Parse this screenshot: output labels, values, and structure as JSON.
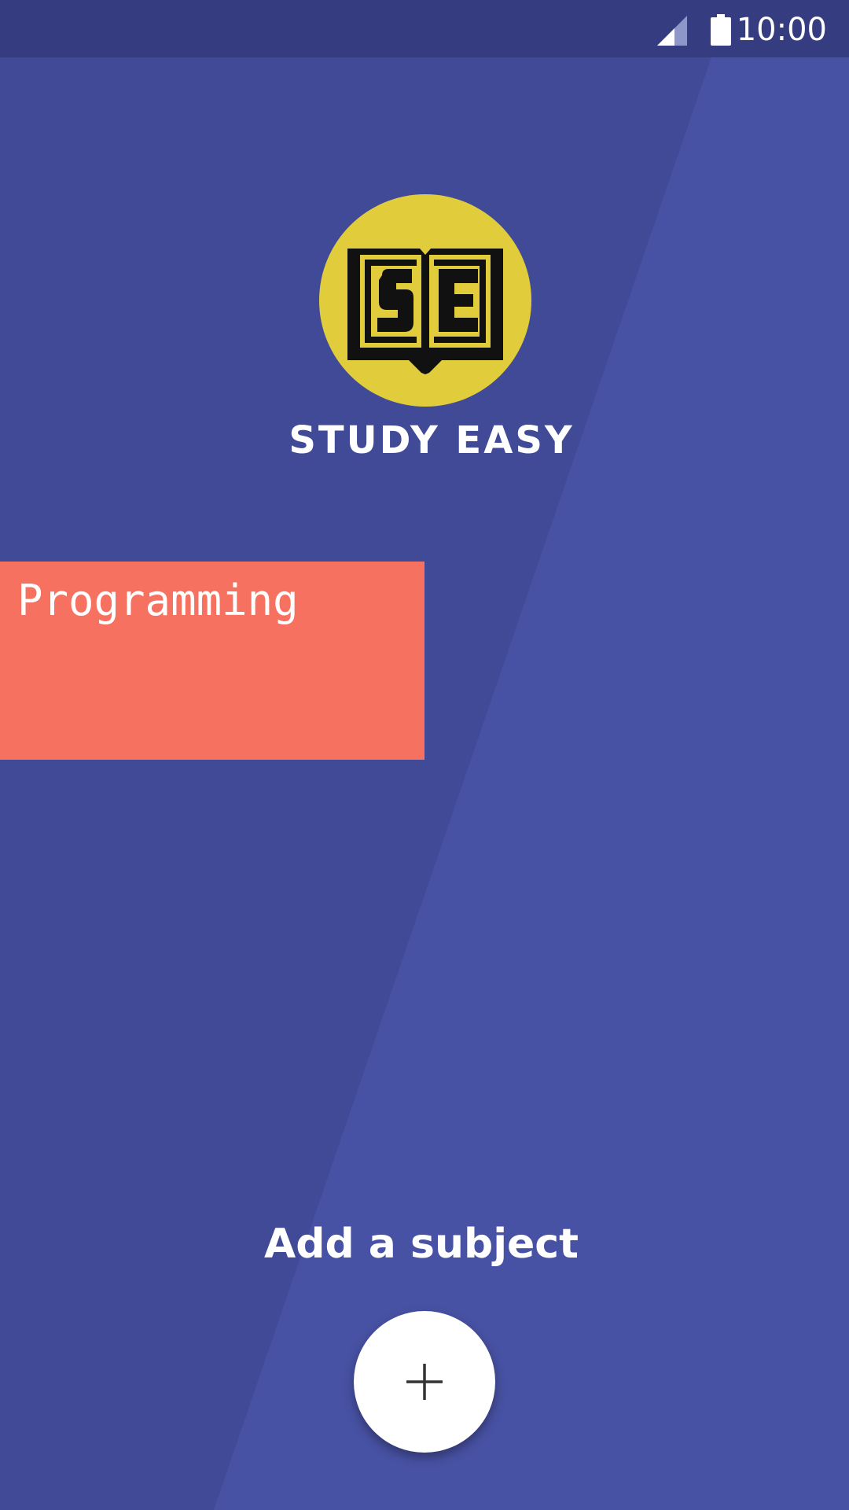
{
  "colors": {
    "background": "#404a97",
    "background_light": "#4852a4",
    "status_bar": "#353d80",
    "logo_circle": "#e1cd3b",
    "card": "#f77161",
    "fab": "#ffffff"
  },
  "status_bar": {
    "time": "10:00",
    "icons": [
      "signal-icon",
      "battery-icon"
    ]
  },
  "logo": {
    "icon": "open-book-logo",
    "monogram": "SE",
    "title": "STUDY EASY"
  },
  "subjects": [
    {
      "label": "Programming"
    }
  ],
  "add_subject": {
    "label": "Add a subject",
    "icon": "plus-icon"
  }
}
